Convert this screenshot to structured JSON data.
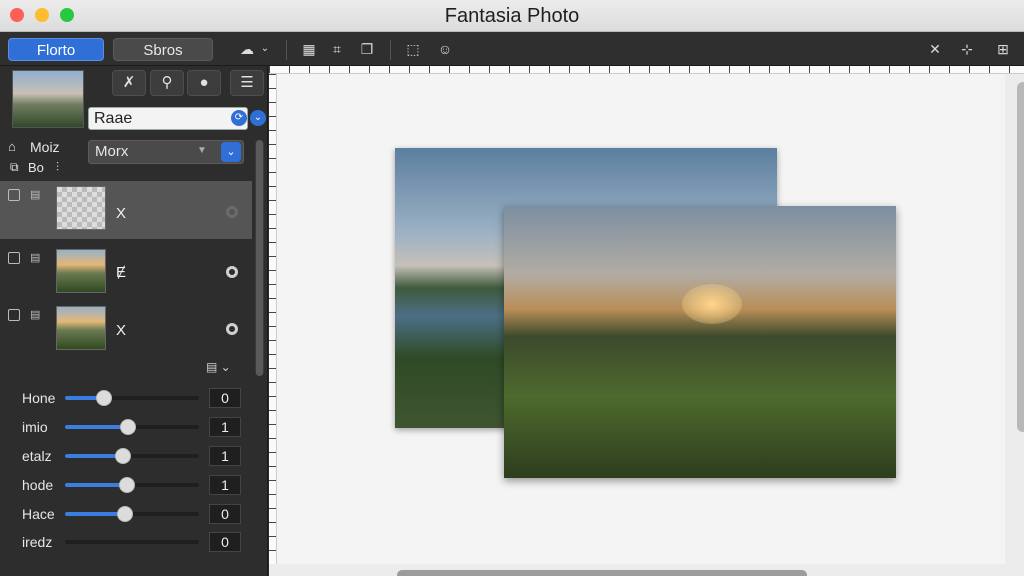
{
  "window": {
    "title": "Fantasia Photo",
    "traffic_lights": {
      "close": "#ff5f57",
      "minimize": "#febc2e",
      "zoom": "#28c840"
    }
  },
  "toolbar": {
    "tab_primary": "Florto",
    "tab_secondary": "Sbros",
    "icons_left": [
      "cloud-icon",
      "chevron-down-icon",
      "grid-icon",
      "crop-icon",
      "copy-icon",
      "select-icon",
      "chat-icon"
    ],
    "icons_right": [
      "transform-icon",
      "align-icon",
      "grid-plus-icon"
    ]
  },
  "sidebar": {
    "tool_icons": [
      "magic-wand-icon",
      "brush-icon",
      "person-icon",
      "menu-icon"
    ],
    "name_field": {
      "value": "Raae"
    },
    "mode_label": "Moiz",
    "blend_mode_label": "Bo",
    "blend_dropdown": {
      "selected": "Morx"
    },
    "layers": [
      {
        "name": "X",
        "selected": true
      },
      {
        "name": "Ɇ",
        "selected": false
      },
      {
        "name": "X",
        "selected": false
      }
    ],
    "adjust_header_icon": "panel-icon",
    "adjustments": [
      {
        "label": "Hone",
        "value": "0",
        "level": 0.29
      },
      {
        "label": "imio",
        "value": "1",
        "level": 0.47
      },
      {
        "label": "etalz",
        "value": "1",
        "level": 0.43
      },
      {
        "label": "hode",
        "value": "1",
        "level": 0.46
      },
      {
        "label": "Hace",
        "value": "0",
        "level": 0.45
      },
      {
        "label": "iredz",
        "value": "0",
        "level": 0.0
      }
    ]
  },
  "colors": {
    "accent": "#2f6fd6",
    "slider_fill": "#3b7de0"
  }
}
